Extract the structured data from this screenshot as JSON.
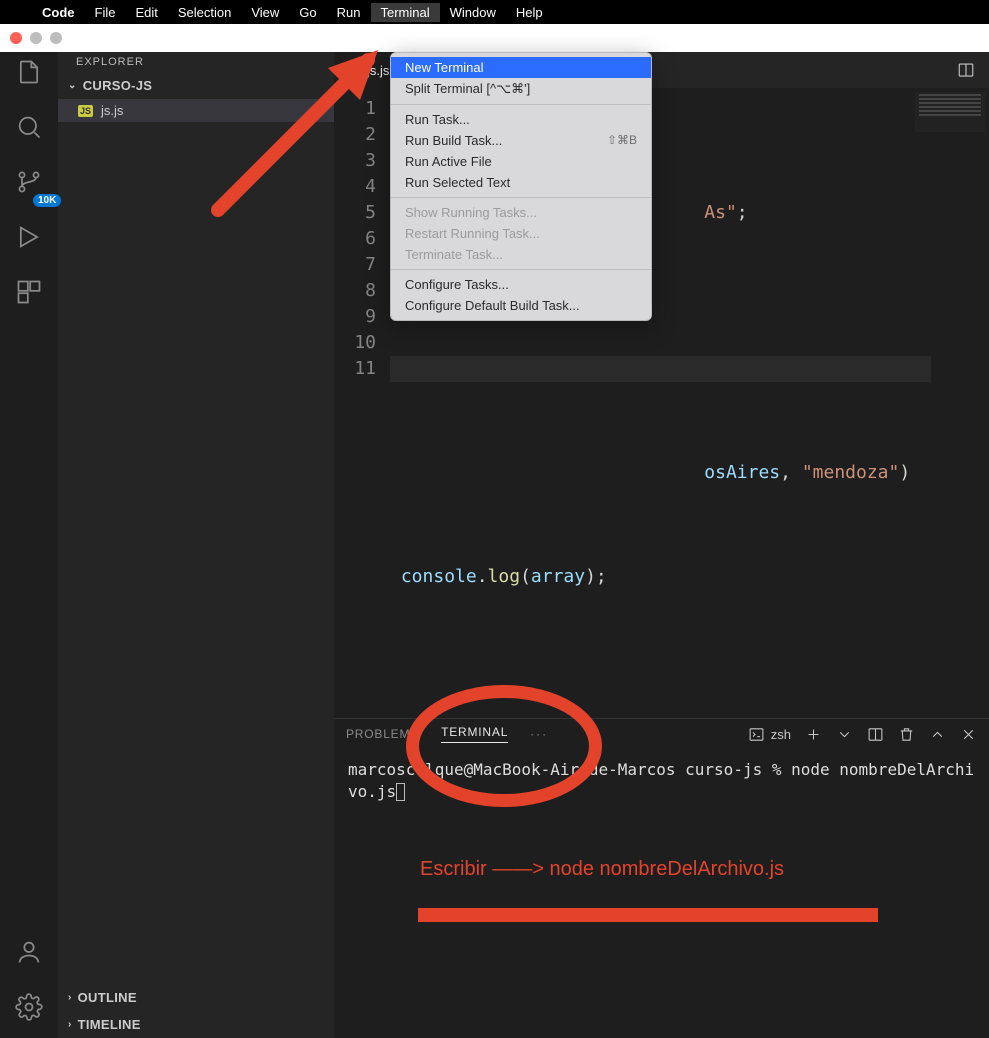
{
  "menubar": {
    "appname": "Code",
    "items": [
      "File",
      "Edit",
      "Selection",
      "View",
      "Go",
      "Run",
      "Terminal",
      "Window",
      "Help"
    ],
    "active_item": "Terminal"
  },
  "activitybar": {
    "badge": "10K"
  },
  "sidebar": {
    "explorer_label": "EXPLORER",
    "folder": "CURSO-JS",
    "file_icon_label": "JS",
    "file": "js.js",
    "outline": "OUTLINE",
    "timeline": "TIMELINE"
  },
  "tabs": {
    "file_icon_label": "JS",
    "active": "js.js"
  },
  "code": {
    "line_numbers": [
      "1",
      "2",
      "3",
      "4",
      "5",
      "6",
      "7",
      "8",
      "9",
      "10",
      "11"
    ],
    "frag_l2_str": "As\"",
    "frag_l2_semi": ";",
    "frag_l7_var": "osAires",
    "frag_l7_comma": ", ",
    "frag_l7_str": "\"mendoza\"",
    "frag_l7_paren": ")",
    "frag_l9_obj": "console",
    "frag_l9_dot": ".",
    "frag_l9_fn": "log",
    "frag_l9_open": "(",
    "frag_l9_arg": "array",
    "frag_l9_close": ");"
  },
  "dropdown": {
    "items": [
      {
        "label": "New Terminal",
        "shortcut": "",
        "state": "selected"
      },
      {
        "label": "Split Terminal [^⌥⌘']",
        "shortcut": "",
        "state": ""
      },
      {
        "sep": true
      },
      {
        "label": "Run Task...",
        "shortcut": "",
        "state": ""
      },
      {
        "label": "Run Build Task...",
        "shortcut": "⇧⌘B",
        "state": ""
      },
      {
        "label": "Run Active File",
        "shortcut": "",
        "state": ""
      },
      {
        "label": "Run Selected Text",
        "shortcut": "",
        "state": ""
      },
      {
        "sep": true
      },
      {
        "label": "Show Running Tasks...",
        "shortcut": "",
        "state": "disabled"
      },
      {
        "label": "Restart Running Task...",
        "shortcut": "",
        "state": "disabled"
      },
      {
        "label": "Terminate Task...",
        "shortcut": "",
        "state": "disabled"
      },
      {
        "sep": true
      },
      {
        "label": "Configure Tasks...",
        "shortcut": "",
        "state": ""
      },
      {
        "label": "Configure Default Build Task...",
        "shortcut": "",
        "state": ""
      }
    ]
  },
  "panel": {
    "tabs": {
      "problems": "PROBLEMS",
      "terminal": "TERMINAL",
      "more": "···"
    },
    "shell": "zsh",
    "prompt": "marcoscolque@MacBook-Air-de-Marcos curso-js % node nombreDelArchivo.js"
  },
  "annotations": {
    "text": "Escribir   ——> node nombreDelArchivo.js"
  }
}
